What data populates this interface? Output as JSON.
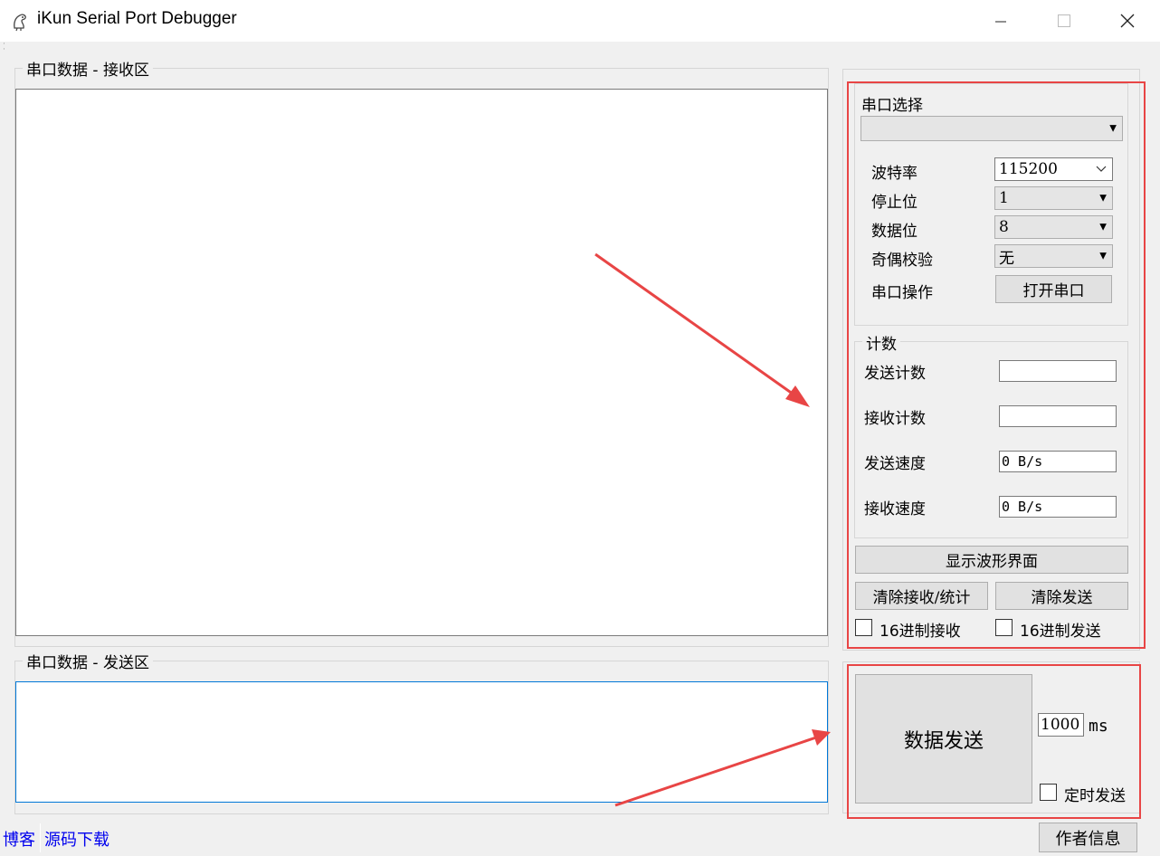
{
  "window": {
    "title": "iKun Serial Port Debugger",
    "controls": {
      "minimize": "—",
      "maximize": "☐",
      "close": "✕"
    }
  },
  "receive": {
    "title": "串口数据 - 接收区",
    "content": ""
  },
  "send": {
    "title": "串口数据 - 发送区",
    "content": ""
  },
  "port": {
    "select_label": "串口选择",
    "selected_port": "",
    "baud_label": "波特率",
    "baud_value": "115200",
    "stop_label": "停止位",
    "stop_value": "1",
    "data_label": "数据位",
    "data_value": "8",
    "parity_label": "奇偶校验",
    "parity_value": "无",
    "op_label": "串口操作",
    "open_button": "打开串口"
  },
  "counts": {
    "title": "计数",
    "send_count_label": "发送计数",
    "send_count_value": "",
    "recv_count_label": "接收计数",
    "recv_count_value": "",
    "send_speed_label": "发送速度",
    "send_speed_value": "0 B/s",
    "recv_speed_label": "接收速度",
    "recv_speed_value": "0 B/s"
  },
  "actions": {
    "waveform_button": "显示波形界面",
    "clear_recv_button": "清除接收/统计",
    "clear_send_button": "清除发送",
    "hex_recv_label": "16进制接收",
    "hex_send_label": "16进制发送"
  },
  "send_panel": {
    "send_button": "数据发送",
    "interval_value": "1000",
    "interval_unit": "ms",
    "timed_send_label": "定时发送"
  },
  "footer": {
    "blog_link": "博客",
    "source_link": "源码下载",
    "author_button": "作者信息"
  },
  "colors": {
    "annotation": "#e84545",
    "link": "#0000ee",
    "focus_border": "#0078d7"
  },
  "icons": {
    "app": "kun-icon",
    "hex_recv": "checkbox-icon",
    "hex_send": "checkbox-icon",
    "timed": "checkbox-icon"
  }
}
